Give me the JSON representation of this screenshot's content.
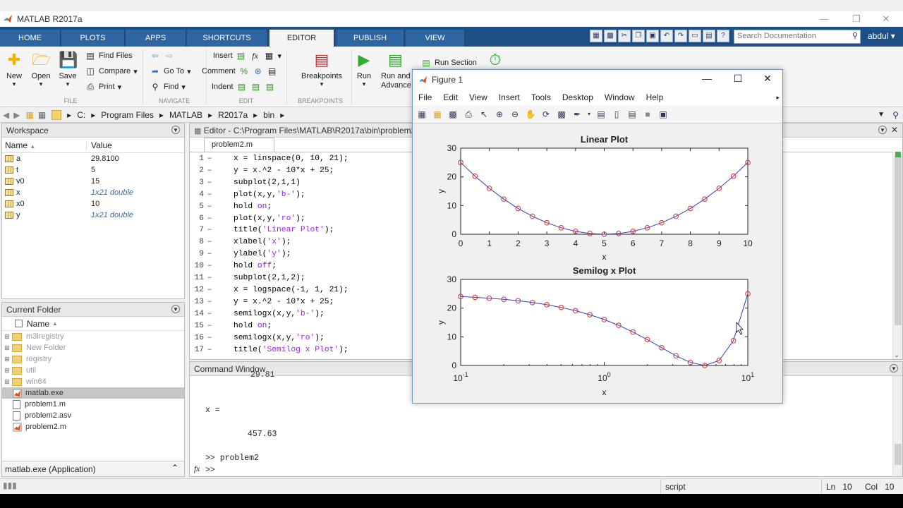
{
  "window": {
    "title": "MATLAB R2017a"
  },
  "tabs": [
    "HOME",
    "PLOTS",
    "APPS",
    "SHORTCUTS",
    "EDITOR",
    "PUBLISH",
    "VIEW"
  ],
  "active_tab": "EDITOR",
  "search": {
    "placeholder": "Search Documentation"
  },
  "user": "abdul",
  "ribbon": {
    "new": "New",
    "open": "Open",
    "save": "Save",
    "find_files": "Find Files",
    "compare": "Compare",
    "print": "Print",
    "go_to": "Go To",
    "find": "Find",
    "insert": "Insert",
    "comment": "Comment",
    "indent": "Indent",
    "breakpoints": "Breakpoints",
    "run": "Run",
    "run_advance": "Run and Advance",
    "run_section": "Run Section",
    "sec_file": "FILE",
    "sec_navigate": "NAVIGATE",
    "sec_edit": "EDIT",
    "sec_breakpoints": "BREAKPOINTS"
  },
  "path": [
    "C:",
    "Program Files",
    "MATLAB",
    "R2017a",
    "bin"
  ],
  "workspace": {
    "title": "Workspace",
    "col_name": "Name",
    "col_value": "Value",
    "vars": [
      {
        "name": "a",
        "value": "29.8100",
        "italic": false
      },
      {
        "name": "t",
        "value": "5",
        "italic": false
      },
      {
        "name": "v0",
        "value": "15",
        "italic": false
      },
      {
        "name": "x",
        "value": "1x21 double",
        "italic": true
      },
      {
        "name": "x0",
        "value": "10",
        "italic": false
      },
      {
        "name": "y",
        "value": "1x21 double",
        "italic": true
      }
    ]
  },
  "current_folder": {
    "title": "Current Folder",
    "col_name": "Name",
    "items": [
      {
        "name": "m3iregistry",
        "type": "folder"
      },
      {
        "name": "New Folder",
        "type": "folder"
      },
      {
        "name": "registry",
        "type": "folder"
      },
      {
        "name": "util",
        "type": "folder"
      },
      {
        "name": "win64",
        "type": "folder"
      },
      {
        "name": "matlab.exe",
        "type": "exe"
      },
      {
        "name": "problem1.m",
        "type": "file"
      },
      {
        "name": "problem2.asv",
        "type": "file"
      },
      {
        "name": "problem2.m",
        "type": "mfile"
      }
    ],
    "details": "matlab.exe  (Application)"
  },
  "editor": {
    "title": "Editor - C:\\Program Files\\MATLAB\\R2017a\\bin\\problem2.m",
    "tab": "problem2.m",
    "lines": [
      "x = linspace(0, 10, 21);",
      "y = x.^2 - 10*x + 25;",
      "subplot(2,1,1)",
      "plot(x,y,'b-');",
      "hold on;",
      "plot(x,y,'ro');",
      "title('Linear Plot');",
      "xlabel('x');",
      "ylabel('y');",
      "hold off;",
      "subplot(2,1,2);",
      "x = logspace(-1, 1, 21);",
      "y = x.^2 - 10*x + 25;",
      "semilogx(x,y,'b-');",
      "hold on;",
      "semilogx(x,y,'ro');",
      "title('Semilog x Plot');"
    ]
  },
  "command_window": {
    "title": "Command Window",
    "partial": "29.81",
    "var_line": "x =",
    "value": "457.63",
    "prompt_cmd": ">> problem2",
    "prompt": ">>"
  },
  "status": {
    "mode": "script",
    "ln_label": "Ln",
    "ln": "10",
    "col_label": "Col",
    "col": "10"
  },
  "figure": {
    "title": "Figure 1",
    "menu": [
      "File",
      "Edit",
      "View",
      "Insert",
      "Tools",
      "Desktop",
      "Window",
      "Help"
    ]
  },
  "chart_data": [
    {
      "type": "line",
      "title": "Linear Plot",
      "xlabel": "x",
      "ylabel": "y",
      "xlim": [
        0,
        10
      ],
      "ylim": [
        0,
        30
      ],
      "xticks": [
        "0",
        "1",
        "2",
        "3",
        "4",
        "5",
        "6",
        "7",
        "8",
        "9",
        "10"
      ],
      "yticks": [
        "0",
        "10",
        "20",
        "30"
      ],
      "x": [
        0,
        0.5,
        1,
        1.5,
        2,
        2.5,
        3,
        3.5,
        4,
        4.5,
        5,
        5.5,
        6,
        6.5,
        7,
        7.5,
        8,
        8.5,
        9,
        9.5,
        10
      ],
      "y": [
        25,
        20.25,
        16,
        12.25,
        9,
        6.25,
        4,
        2.25,
        1,
        0.25,
        0,
        0.25,
        1,
        2.25,
        4,
        6.25,
        9,
        12.25,
        16,
        20.25,
        25
      ],
      "line_color": "#2f3fc8",
      "marker_color": "#e03030"
    },
    {
      "type": "line",
      "title": "Semilog x Plot",
      "xlabel": "x",
      "ylabel": "y",
      "xscale": "log",
      "xlim": [
        0.1,
        10
      ],
      "ylim": [
        0,
        30
      ],
      "yticks": [
        "0",
        "10",
        "20",
        "30"
      ],
      "xticks_base": "10",
      "xticks_exp": [
        "-1",
        "0",
        "1"
      ],
      "x": [
        0.1,
        0.126,
        0.158,
        0.2,
        0.251,
        0.316,
        0.398,
        0.501,
        0.631,
        0.794,
        1,
        1.259,
        1.585,
        1.995,
        2.512,
        3.162,
        3.981,
        5.012,
        6.31,
        7.943,
        10
      ],
      "y": [
        24.01,
        23.76,
        23.44,
        23.04,
        22.55,
        21.94,
        21.18,
        20.24,
        19.09,
        17.69,
        16,
        14.0,
        11.66,
        9.03,
        6.19,
        3.38,
        1.05,
        0,
        1.71,
        8.65,
        25
      ],
      "line_color": "#2f3fc8",
      "marker_color": "#e03030"
    }
  ]
}
